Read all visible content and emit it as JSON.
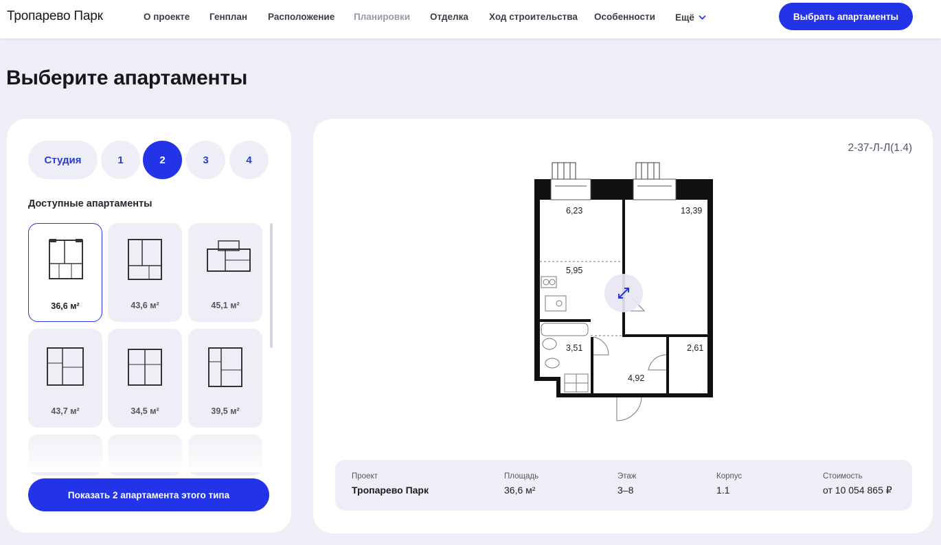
{
  "header": {
    "logo": "Тропарево Парк",
    "nav": [
      "О проекте",
      "Генплан",
      "Расположение",
      "Планировки",
      "Отделка",
      "Ход строительства",
      "Особенности",
      "Ещё"
    ],
    "active_nav": "Планировки",
    "cta": "Выбрать апартаменты"
  },
  "page_title": "Выберите апартаменты",
  "filters": {
    "rooms": [
      "Студия",
      "1",
      "2",
      "3",
      "4"
    ],
    "selected": "2"
  },
  "available": {
    "title": "Доступные апартаменты",
    "cards": [
      {
        "area": "36,6 м²",
        "selected": true
      },
      {
        "area": "43,6 м²"
      },
      {
        "area": "45,1 м²"
      },
      {
        "area": "43,7 м²"
      },
      {
        "area": "34,5 м²"
      },
      {
        "area": "39,5 м²"
      }
    ]
  },
  "show_button": "Показать 2 апартамента этого типа",
  "plan": {
    "code": "2-37-Л-Л(1.4)",
    "rooms": [
      "6,23",
      "13,39",
      "5,95",
      "3,51",
      "2,61",
      "4,92"
    ]
  },
  "info": {
    "project_label": "Проект",
    "project": "Тропарево Парк",
    "area_label": "Площадь",
    "area": "36,6 м²",
    "floor_label": "Этаж",
    "floor": "3–8",
    "building_label": "Корпус",
    "building": "1.1",
    "price_label": "Стоимость",
    "price": "от 10 054 865 ₽"
  },
  "colors": {
    "accent": "#2233e8",
    "background": "#eeeef6",
    "panel": "#ffffff"
  },
  "icons": [
    "chevron-down-icon",
    "expand-icon"
  ]
}
